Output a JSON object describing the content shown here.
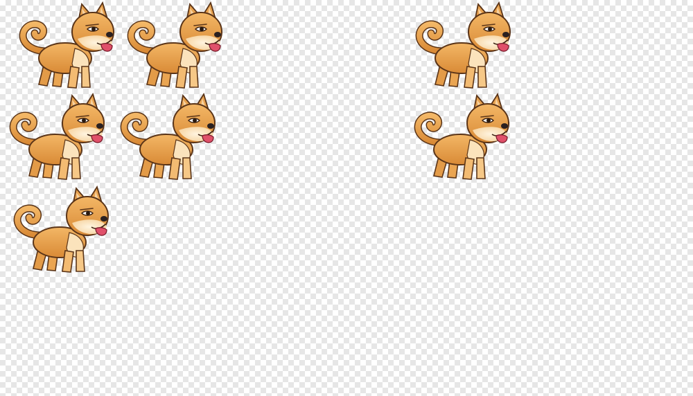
{
  "sprite_sheet": {
    "frame_count": 7,
    "frames": [
      {
        "icon": "shiba-dog-sprite",
        "pose": "stand"
      },
      {
        "icon": "shiba-dog-sprite",
        "pose": "stand"
      },
      {
        "icon": "shiba-dog-sprite",
        "pose": "stand"
      },
      {
        "icon": "shiba-dog-sprite",
        "pose": "step"
      },
      {
        "icon": "shiba-dog-sprite",
        "pose": "step"
      },
      {
        "icon": "shiba-dog-sprite",
        "pose": "step"
      },
      {
        "icon": "shiba-dog-sprite",
        "pose": "stand"
      }
    ]
  },
  "colors": {
    "fur": "#e8a24f",
    "fur_light": "#fbe3bc",
    "outline": "#5a3418",
    "tongue": "#e0506a",
    "nose": "#2a2020",
    "checker_light": "#ffffff",
    "checker_dark": "#e6e6e6"
  }
}
